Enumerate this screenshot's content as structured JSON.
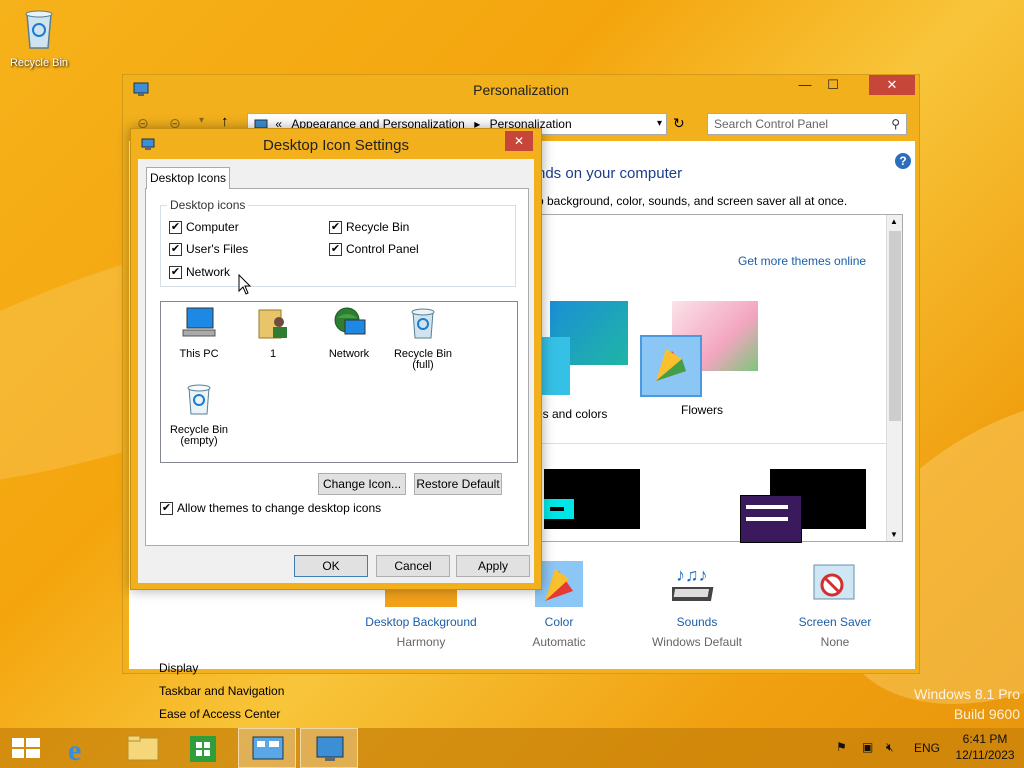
{
  "desktop": {
    "recycle_bin_label": "Recycle Bin",
    "watermark_line1": "Windows 8.1 Pro",
    "watermark_line2": "Build 9600"
  },
  "personalization": {
    "title": "Personalization",
    "breadcrumb_sep": "«",
    "breadcrumb_1": "Appearance and Personalization",
    "breadcrumb_2": "Personalization",
    "search_placeholder": "Search Control Panel",
    "heading": "nds on your computer",
    "subheading": "o background, color, sounds, and screen saver all at once.",
    "get_more_themes": "Get more themes online",
    "theme_1_label": "es and colors",
    "theme_2_label": "Flowers",
    "side_links": [
      "Display",
      "Taskbar and Navigation",
      "Ease of Access Center"
    ],
    "bottom_items": [
      {
        "label": "Desktop Background",
        "sub": "Harmony"
      },
      {
        "label": "Color",
        "sub": "Automatic"
      },
      {
        "label": "Sounds",
        "sub": "Windows Default"
      },
      {
        "label": "Screen Saver",
        "sub": "None"
      }
    ]
  },
  "dialog": {
    "title": "Desktop Icon Settings",
    "tab": "Desktop Icons",
    "group_label": "Desktop icons",
    "checkboxes": [
      {
        "label": "Computer",
        "checked": true
      },
      {
        "label": "Recycle Bin",
        "checked": true
      },
      {
        "label": "User's Files",
        "checked": true
      },
      {
        "label": "Control Panel",
        "checked": true
      },
      {
        "label": "Network",
        "checked": true
      }
    ],
    "icons": [
      {
        "label": "This PC"
      },
      {
        "label": "1"
      },
      {
        "label": "Network"
      },
      {
        "label": "Recycle Bin\n(full)"
      },
      {
        "label": "Recycle Bin\n(empty)"
      }
    ],
    "change_icon": "Change Icon...",
    "restore_default": "Restore Default",
    "allow_themes": "Allow themes to change desktop icons",
    "ok": "OK",
    "cancel": "Cancel",
    "apply": "Apply"
  },
  "taskbar": {
    "language": "ENG",
    "time": "6:41 PM",
    "date": "12/11/2023"
  }
}
